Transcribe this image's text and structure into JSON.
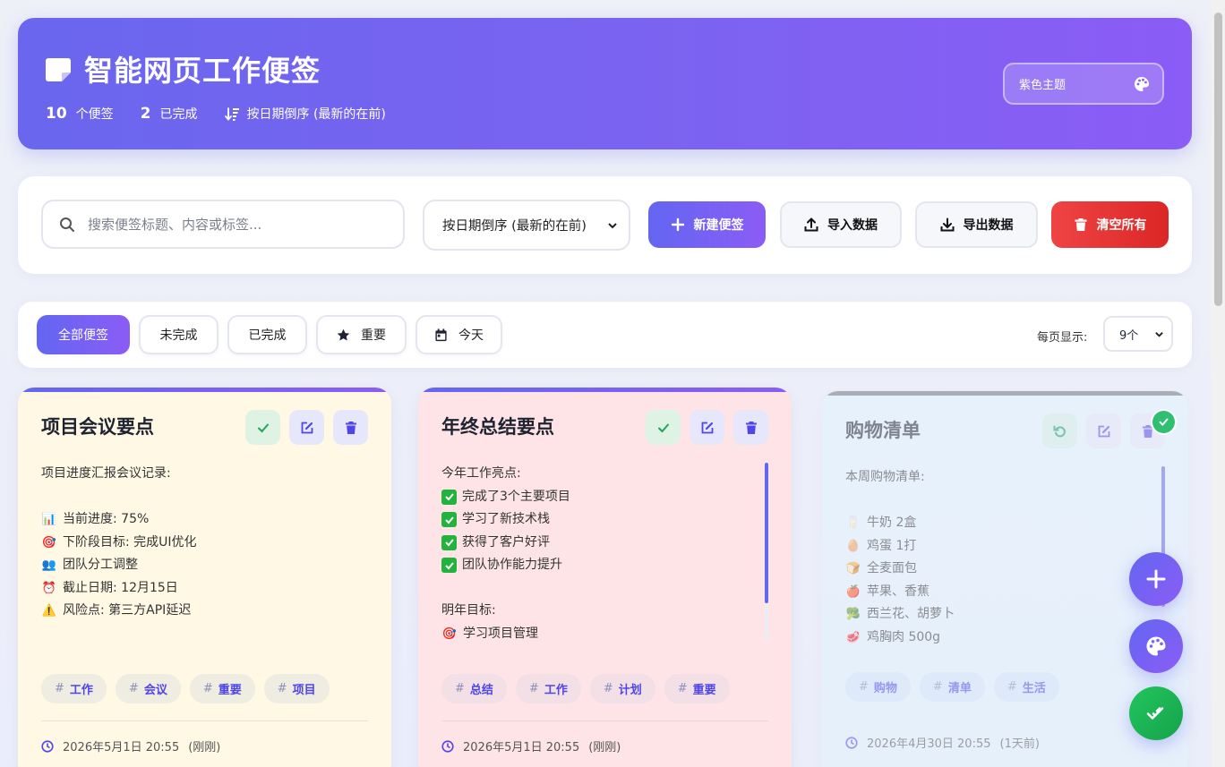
{
  "header": {
    "title": "智能网页工作便签",
    "stats": {
      "total_count": "10",
      "total_label": "个便签",
      "done_count": "2",
      "done_label": "已完成",
      "sort_label": "按日期倒序 (最新的在前)"
    },
    "theme_label": "紫色主题"
  },
  "toolbar": {
    "search_placeholder": "搜索便签标题、内容或标签...",
    "sort_selected": "按日期倒序 (最新的在前)",
    "new_label": "新建便签",
    "import_label": "导入数据",
    "export_label": "导出数据",
    "clear_label": "清空所有"
  },
  "filters": {
    "all": "全部便签",
    "todo": "未完成",
    "done": "已完成",
    "important": "重要",
    "today": "今天",
    "per_page_label": "每页显示:",
    "per_page_value": "9个"
  },
  "notes": [
    {
      "title": "项目会议要点",
      "intro": "项目进度汇报会议记录:",
      "lines": [
        {
          "emoji": "📊",
          "text": "当前进度: 75%"
        },
        {
          "emoji": "🎯",
          "text": "下阶段目标: 完成UI优化"
        },
        {
          "emoji": "👥",
          "text": "团队分工调整"
        },
        {
          "emoji": "⏰",
          "text": "截止日期: 12月15日"
        },
        {
          "emoji": "⚠️",
          "text": "风险点: 第三方API延迟"
        }
      ],
      "tags": [
        "工作",
        "会议",
        "重要",
        "项目"
      ],
      "date": "2026年5月1日 20:55",
      "relative": "(刚刚)"
    },
    {
      "title": "年终总结要点",
      "intro": "今年工作亮点:",
      "lines": [
        {
          "text": "完成了3个主要项目"
        },
        {
          "text": "学习了新技术栈"
        },
        {
          "text": "获得了客户好评"
        },
        {
          "text": "团队协作能力提升"
        }
      ],
      "section2": "明年目标:",
      "line2": {
        "emoji": "🎯",
        "text": "学习项目管理"
      },
      "tags": [
        "总结",
        "工作",
        "计划",
        "重要"
      ],
      "date": "2026年5月1日 20:55",
      "relative": "(刚刚)"
    },
    {
      "title": "购物清单",
      "intro": "本周购物清单:",
      "lines": [
        {
          "emoji": "🥛",
          "text": "牛奶 2盒"
        },
        {
          "emoji": "🥚",
          "text": "鸡蛋 1打"
        },
        {
          "emoji": "🍞",
          "text": "全麦面包"
        },
        {
          "emoji": "🍎",
          "text": "苹果、香蕉"
        },
        {
          "emoji": "🥦",
          "text": "西兰花、胡萝卜"
        },
        {
          "emoji": "🥩",
          "text": "鸡胸肉 500g"
        }
      ],
      "tags": [
        "购物",
        "清单",
        "生活"
      ],
      "date": "2026年4月30日 20:55",
      "relative": "(1天前)"
    }
  ],
  "colors": {
    "accent": "#6366f1",
    "accent2": "#8b5cf6",
    "danger": "#ef4444",
    "success": "#22c55e"
  }
}
